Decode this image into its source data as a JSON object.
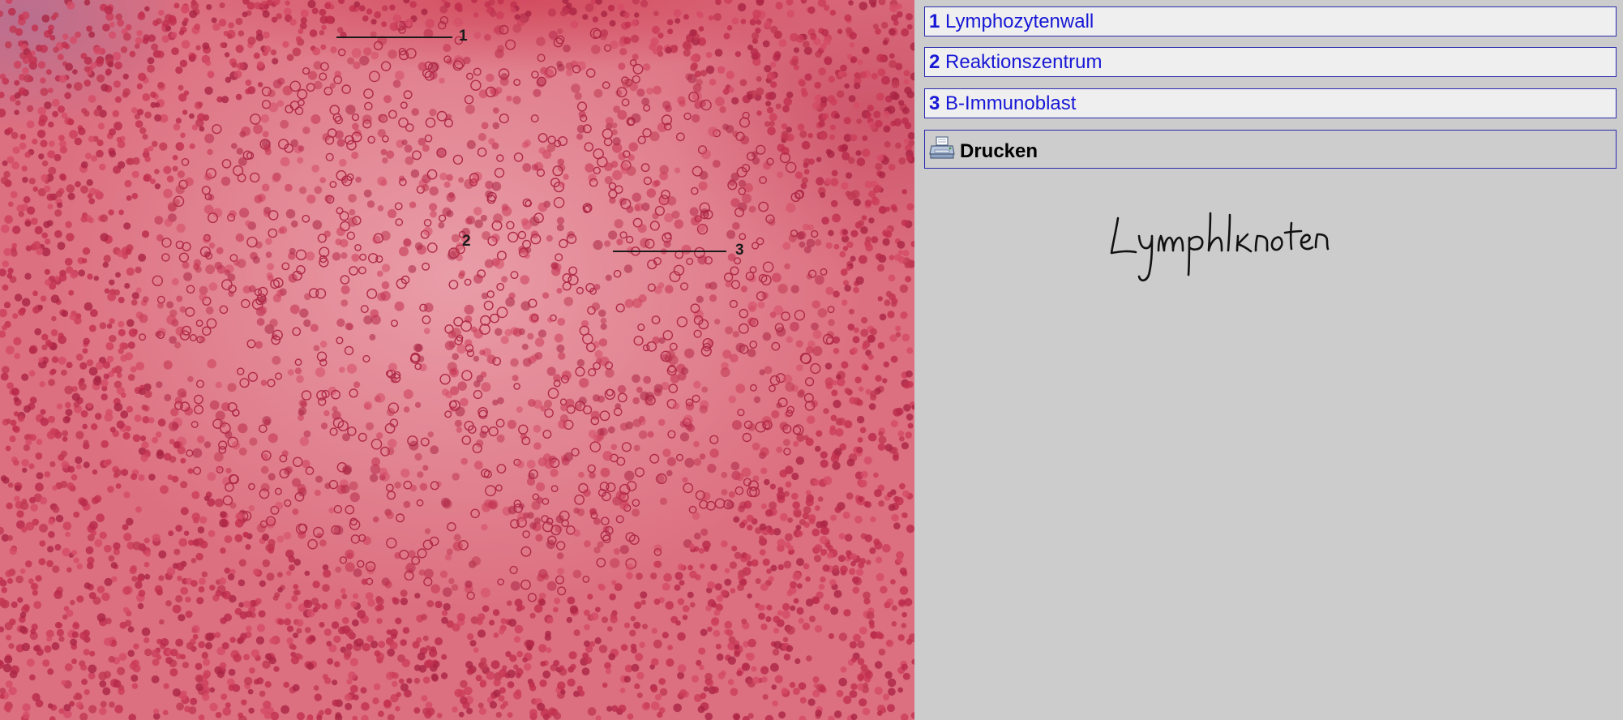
{
  "image": {
    "labels": [
      "1",
      "2",
      "3"
    ]
  },
  "legend": {
    "items": [
      {
        "number": "1",
        "label": "Lymphozytenwall"
      },
      {
        "number": "2",
        "label": "Reaktionszentrum"
      },
      {
        "number": "3",
        "label": "B-Immunoblast"
      }
    ]
  },
  "print": {
    "label": "Drucken",
    "icon": "printer-icon"
  },
  "handwritten_title": "Lymphknoten",
  "colors": {
    "link": "#1717d6",
    "border": "#2b2bb0",
    "button_bg": "#efefef",
    "panel_bg": "#cccccc",
    "tissue": "#dc6f80"
  }
}
